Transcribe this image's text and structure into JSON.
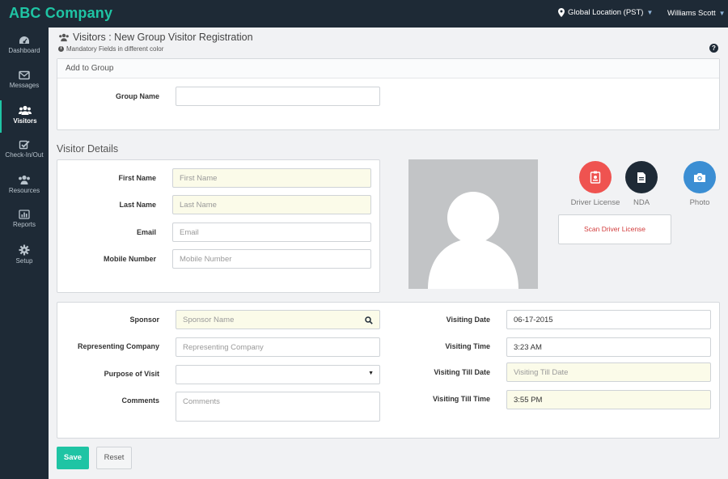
{
  "app": {
    "brand": "ABC Company",
    "location": "Global Location (PST)",
    "user": "Williams Scott"
  },
  "sidebar": {
    "items": [
      {
        "label": "Dashboard",
        "icon": "dashboard-icon"
      },
      {
        "label": "Messages",
        "icon": "envelope-icon"
      },
      {
        "label": "Visitors",
        "icon": "users-icon",
        "active": true
      },
      {
        "label": "Check-In/Out",
        "icon": "checkbox-icon"
      },
      {
        "label": "Resources",
        "icon": "group-icon"
      },
      {
        "label": "Reports",
        "icon": "bar-chart-icon"
      },
      {
        "label": "Setup",
        "icon": "gear-icon"
      }
    ]
  },
  "page": {
    "title": "Visitors : New Group Visitor Registration",
    "note": "Mandatory Fields in different color"
  },
  "group": {
    "header": "Add to Group",
    "name_label": "Group Name",
    "name_value": ""
  },
  "visitor": {
    "section_title": "Visitor Details",
    "first_name_label": "First Name",
    "first_name_placeholder": "First Name",
    "last_name_label": "Last Name",
    "last_name_placeholder": "Last Name",
    "email_label": "Email",
    "email_placeholder": "Email",
    "mobile_label": "Mobile Number",
    "mobile_placeholder": "Mobile Number"
  },
  "actions": {
    "driver_license": "Driver License",
    "nda": "NDA",
    "photo": "Photo",
    "scan": "Scan Driver License"
  },
  "visit": {
    "sponsor_label": "Sponsor",
    "sponsor_placeholder": "Sponsor Name",
    "company_label": "Representing Company",
    "company_placeholder": "Representing Company",
    "purpose_label": "Purpose of Visit",
    "purpose_value": "",
    "comments_label": "Comments",
    "comments_placeholder": "Comments",
    "date_label": "Visiting Date",
    "date_value": "06-17-2015",
    "time_label": "Visiting Time",
    "time_value": "3:23 AM",
    "till_date_label": "Visiting Till Date",
    "till_date_placeholder": "Visiting Till Date",
    "till_time_label": "Visiting Till Time",
    "till_time_value": "3:55 PM"
  },
  "buttons": {
    "save": "Save",
    "reset": "Reset"
  },
  "colors": {
    "accent": "#1fc4a4",
    "sidebar": "#1e2a36",
    "driver_license": "#ef5350",
    "nda": "#1e2a36",
    "photo": "#3b8ed3",
    "mandatory_bg": "#fbfbe9"
  }
}
